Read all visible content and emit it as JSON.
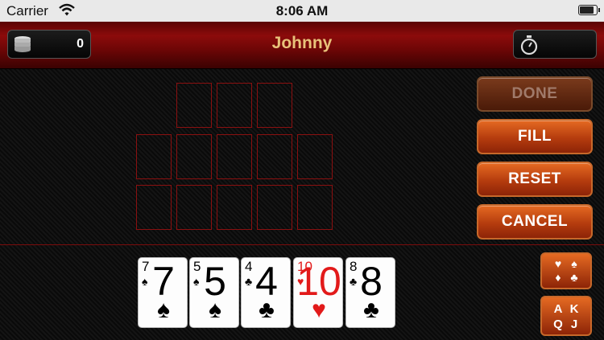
{
  "status_bar": {
    "carrier": "Carrier",
    "time": "8:06 AM",
    "battery_level": 0.95
  },
  "header": {
    "player_name": "Johnny",
    "coin_count": "0"
  },
  "buttons": {
    "done": "DONE",
    "fill": "FILL",
    "reset": "RESET",
    "cancel": "CANCEL"
  },
  "hand": [
    {
      "rank": "7",
      "suit": "♠",
      "color": "black"
    },
    {
      "rank": "5",
      "suit": "♠",
      "color": "black"
    },
    {
      "rank": "4",
      "suit": "♣",
      "color": "black"
    },
    {
      "rank": "10",
      "suit": "♥",
      "color": "red"
    },
    {
      "rank": "8",
      "suit": "♣",
      "color": "black"
    }
  ],
  "sort_buttons": {
    "suit_sort": [
      "♥",
      "♠",
      "♦",
      "♣"
    ],
    "rank_sort": [
      "A",
      "K",
      "Q",
      "J"
    ]
  },
  "colors": {
    "accent": "#d9541a",
    "header_red": "#8c0b0b",
    "title_gold": "#e8c27a",
    "slot_border": "#8a1010"
  }
}
